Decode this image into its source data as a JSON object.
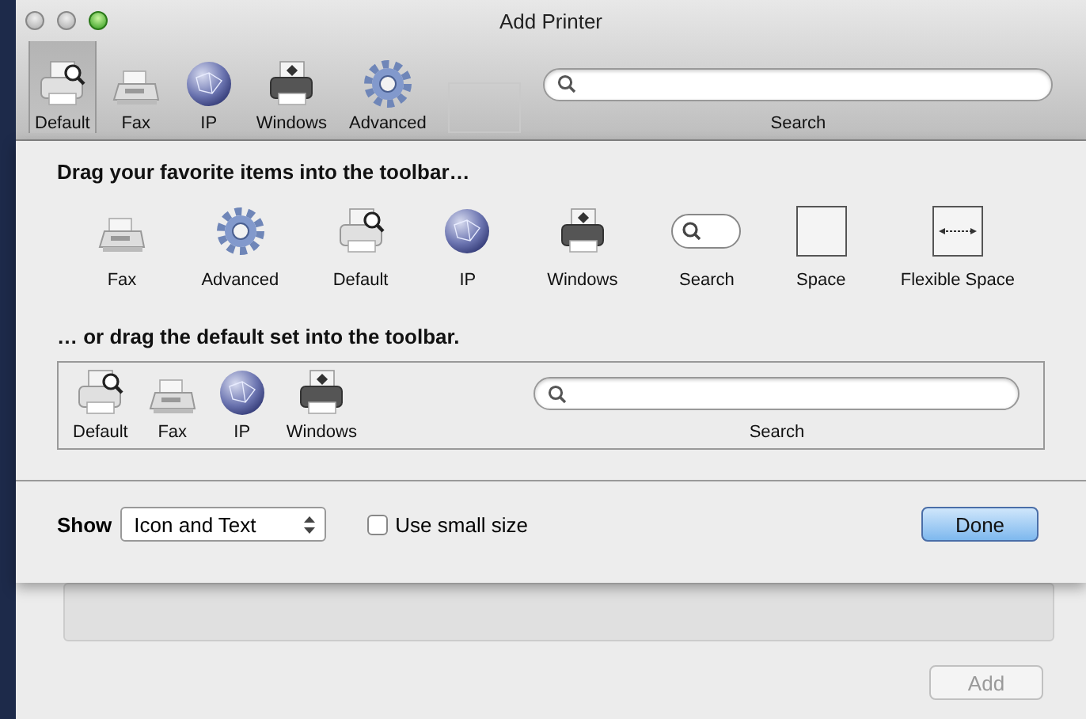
{
  "window": {
    "title": "Add Printer"
  },
  "toolbar": {
    "items": [
      {
        "kind": "default",
        "label": "Default",
        "selected": true
      },
      {
        "kind": "fax",
        "label": "Fax",
        "selected": false
      },
      {
        "kind": "ip",
        "label": "IP",
        "selected": false
      },
      {
        "kind": "windows",
        "label": "Windows",
        "selected": false
      },
      {
        "kind": "advanced",
        "label": "Advanced",
        "selected": false
      },
      {
        "kind": "space"
      },
      {
        "kind": "search",
        "label": "Search"
      }
    ]
  },
  "sheet": {
    "palette_heading": "Drag your favorite items into the toolbar…",
    "palette": [
      {
        "kind": "fax",
        "label": "Fax"
      },
      {
        "kind": "advanced",
        "label": "Advanced"
      },
      {
        "kind": "default",
        "label": "Default"
      },
      {
        "kind": "ip",
        "label": "IP"
      },
      {
        "kind": "windows",
        "label": "Windows"
      },
      {
        "kind": "search",
        "label": "Search"
      },
      {
        "kind": "space",
        "label": "Space"
      },
      {
        "kind": "flexible",
        "label": "Flexible Space"
      }
    ],
    "default_set_heading": "… or drag the default set into the toolbar.",
    "default_set": [
      {
        "kind": "default",
        "label": "Default"
      },
      {
        "kind": "fax",
        "label": "Fax"
      },
      {
        "kind": "ip",
        "label": "IP"
      },
      {
        "kind": "windows",
        "label": "Windows"
      },
      {
        "kind": "search",
        "label": "Search"
      }
    ],
    "show_label": "Show",
    "show_popup": "Icon and Text",
    "small_size": {
      "label": "Use small size",
      "checked": false
    },
    "done_button": "Done"
  },
  "add_button": {
    "label": "Add",
    "disabled": true
  }
}
